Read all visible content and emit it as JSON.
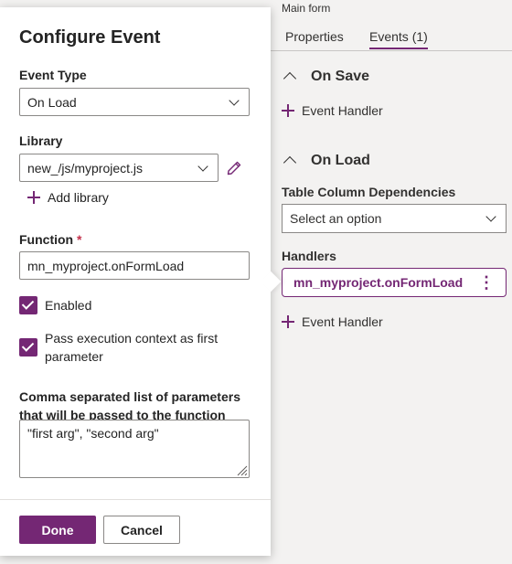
{
  "right_panel": {
    "breadcrumb": "Main form",
    "tabs": [
      {
        "label": "Properties",
        "active": false
      },
      {
        "label": "Events (1)",
        "active": true
      }
    ],
    "on_save": {
      "title": "On Save",
      "add_handler_label": "Event Handler"
    },
    "on_load": {
      "title": "On Load",
      "dependencies_label": "Table Column Dependencies",
      "dependencies_placeholder": "Select an option",
      "handlers_label": "Handlers",
      "handler_name": "mn_myproject.onFormLoad",
      "add_handler_label": "Event Handler"
    }
  },
  "dialog": {
    "title": "Configure Event",
    "event_type": {
      "label": "Event Type",
      "value": "On Load"
    },
    "library": {
      "label": "Library",
      "value": "new_/js/myproject.js",
      "add_label": "Add library"
    },
    "function": {
      "label": "Function",
      "required_mark": "*",
      "value": "mn_myproject.onFormLoad"
    },
    "enabled": {
      "label": "Enabled",
      "checked": true
    },
    "pass_context": {
      "label": "Pass execution context as first parameter",
      "checked": true
    },
    "parameters": {
      "label": "Comma separated list of parameters that will be passed to the function",
      "value": "\"first arg\", \"second arg\""
    },
    "buttons": {
      "done": "Done",
      "cancel": "Cancel"
    }
  },
  "colors": {
    "accent": "#742774",
    "required": "#c4314b",
    "border": "#8a8886",
    "background": "#f3f2f1"
  }
}
